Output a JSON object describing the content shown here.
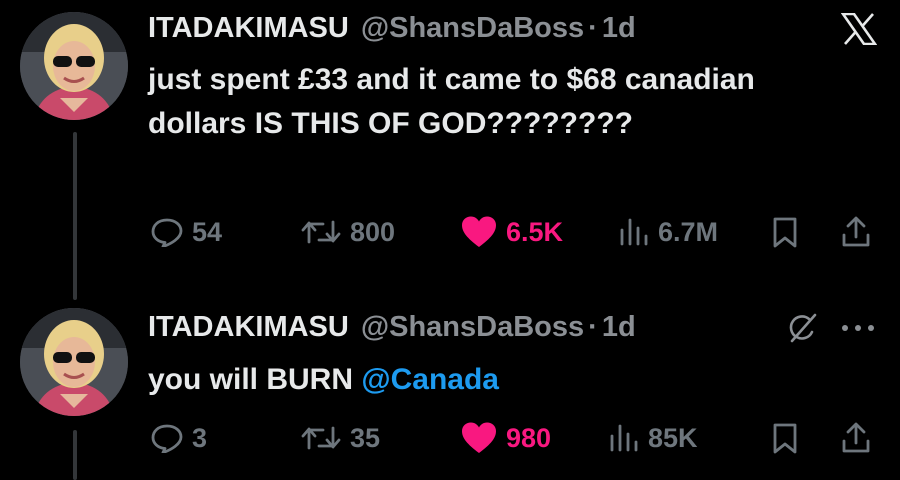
{
  "tweets": [
    {
      "display_name": "ITADAKIMASU",
      "handle": "@ShansDaBoss",
      "separator": "·",
      "time": "1d",
      "text": "just spent £33 and it came to $68 canadian dollars IS THIS OF GOD????????",
      "replies": "54",
      "retweets": "800",
      "likes": "6.5K",
      "views": "6.7M",
      "top_icon": "x-logo-icon"
    },
    {
      "display_name": "ITADAKIMASU",
      "handle": "@ShansDaBoss",
      "separator": "·",
      "time": "1d",
      "text_before": "you will BURN ",
      "mention": "@Canada",
      "replies": "3",
      "retweets": "35",
      "likes": "980",
      "views": "85K",
      "top_icons": [
        "grok-icon",
        "more-icon"
      ]
    }
  ],
  "colors": {
    "background": "#000000",
    "text": "#e7e9ea",
    "muted": "#6e767d",
    "like": "#f91880",
    "mention": "#1d9bf0"
  }
}
